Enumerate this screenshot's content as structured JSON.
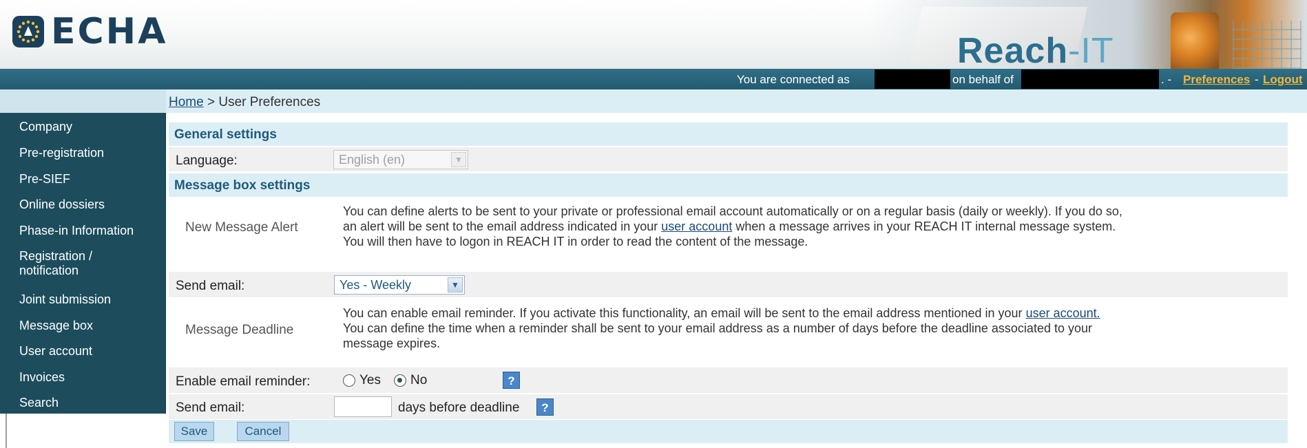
{
  "header": {
    "logo_text": "ECHA",
    "brand_main": "Reach",
    "brand_suffix": "-IT"
  },
  "connection": {
    "connected_as": "You are connected as",
    "on_behalf_of": "on behalf of",
    "separator1": ". -",
    "preferences": "Preferences",
    "separator2": "-",
    "logout": "Logout"
  },
  "breadcrumb": {
    "home": "Home",
    "separator": ">",
    "current": "User Preferences"
  },
  "sidebar": {
    "items": [
      {
        "label": "Company"
      },
      {
        "label": "Pre-registration"
      },
      {
        "label": "Pre-SIEF"
      },
      {
        "label": "Online dossiers"
      },
      {
        "label": "Phase-in Information"
      },
      {
        "label": "Registration /\nnotification"
      },
      {
        "label": "Joint submission"
      },
      {
        "label": "Message box"
      },
      {
        "label": "User account"
      },
      {
        "label": "Invoices"
      },
      {
        "label": "Search"
      }
    ]
  },
  "general": {
    "header": "General settings",
    "language_label": "Language:",
    "language_value": "English (en)"
  },
  "message_box": {
    "header": "Message box settings",
    "alert_label": "New Message Alert",
    "alert_desc_1": "You can define alerts to be sent to your private or professional email account automatically or on a regular basis (daily or weekly). If you do so,",
    "alert_desc_2a": "an alert will be sent to the email address indicated in your",
    "alert_link": "user account",
    "alert_desc_2b": "when a message arrives in your REACH IT internal message system.",
    "alert_desc_3": "You will then have to logon in REACH IT in order to read the content of the message.",
    "send_email_label": "Send email:",
    "send_email_value": "Yes - Weekly",
    "deadline_label": "Message Deadline",
    "deadline_desc_1a": "You can enable email reminder. If you activate this functionality, an email will be sent to the email address mentioned in your",
    "deadline_link": "user account.",
    "deadline_desc_2": "You can define the time when a reminder shall be sent to your email address as a number of days before the deadline associated to your",
    "deadline_desc_3": "message expires.",
    "reminder_label": "Enable email reminder:",
    "reminder_yes": "Yes",
    "reminder_no": "No",
    "reminder_selected": "No",
    "send_email2_label": "Send email:",
    "days_input_value": "",
    "days_suffix": "days before deadline",
    "help_glyph": "?"
  },
  "buttons": {
    "save": "Save",
    "cancel": "Cancel"
  },
  "colors": {
    "sidebar_bg": "#1d4d5c",
    "conn_bar": "#2f6f86",
    "section_header_bg": "#dceef5",
    "link_accent": "#f3b73a"
  }
}
